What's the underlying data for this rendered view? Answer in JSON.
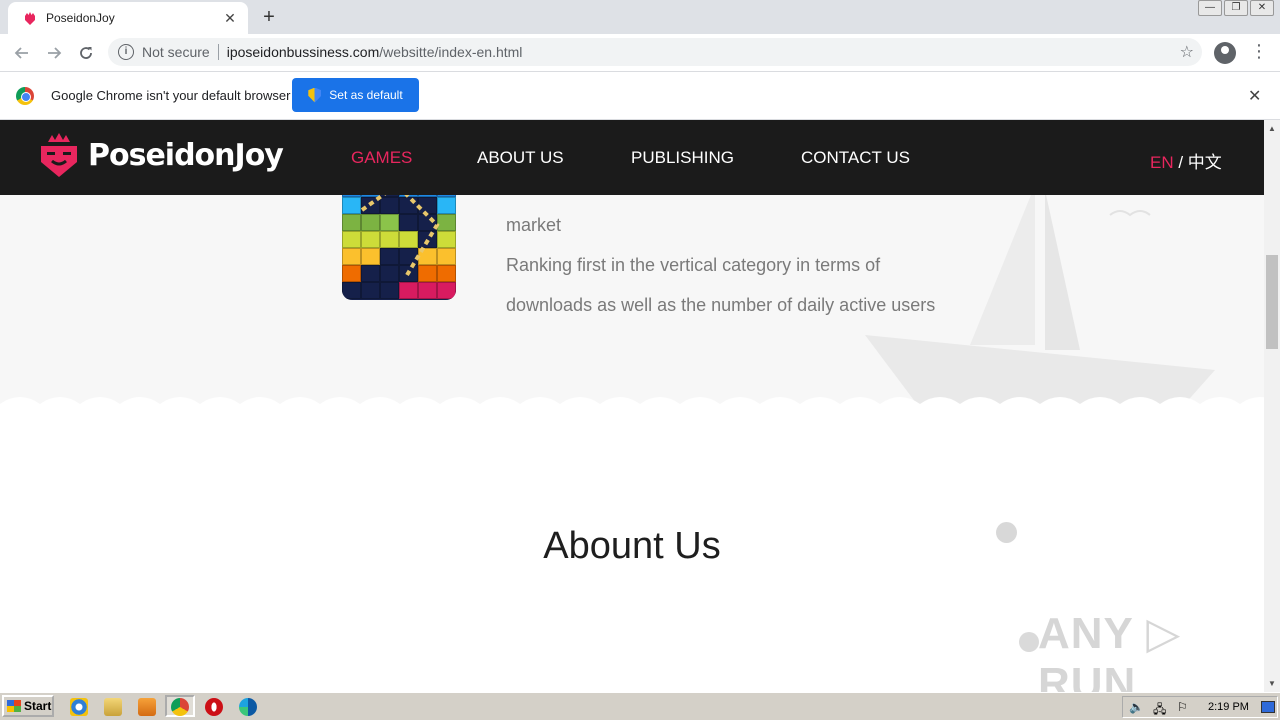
{
  "browser": {
    "tab_title": "PoseidonJoy",
    "tab_close": "✕",
    "new_tab": "+",
    "security_label": "Not secure",
    "url_host": "iposeidonbussiness.com",
    "url_path": "/websitte/index-en.html",
    "window_controls": [
      "—",
      "❐",
      "✕"
    ]
  },
  "infobar": {
    "message": "Google Chrome isn't your default browser",
    "button": "Set as default",
    "close": "✕"
  },
  "site": {
    "brand": "PoseidonJoy",
    "nav": [
      "GAMES",
      "ABOUT US",
      "PUBLISHING",
      "CONTACT US"
    ],
    "active_nav": "GAMES",
    "lang_en": "EN",
    "lang_sep": " / ",
    "lang_zh": "中文",
    "accent_color": "#e8265e"
  },
  "game": {
    "text_line1": "market",
    "text_line2": "Ranking first in the vertical category in terms of",
    "text_line3": "downloads as well as the number of daily active users"
  },
  "about": {
    "title": "Abount Us"
  },
  "watermark": "ANY ▷ RUN",
  "taskbar": {
    "start": "Start",
    "clock": "2:19 PM"
  }
}
